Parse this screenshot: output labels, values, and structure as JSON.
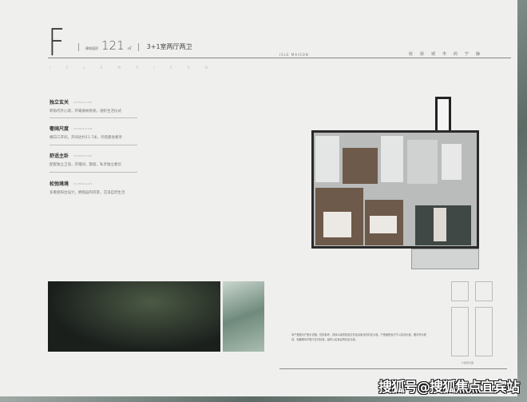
{
  "unit": {
    "letter": "F",
    "area_label": "建筑面积",
    "area": "121",
    "area_unit": "㎡",
    "layout": "3+1室两厅两卫",
    "subtitle": "I S L E M A I S O N"
  },
  "header": {
    "brand": "ISLE MAISON",
    "tagline": "收获城市的宁静"
  },
  "features": [
    {
      "title": "独立玄关",
      "en": "ISLEMAISON",
      "desc": "转角内外心境，开箱收纳系统，进阶生活仪式"
    },
    {
      "title": "奢阔尺度",
      "en": "ISLEMAISON",
      "desc": "横向三开间，开间达约11.7米，尽揽都会奢享"
    },
    {
      "title": "舒适主卧",
      "en": "ISLEMAISON",
      "desc": "配套独立卫浴，衣帽间，飘窗，私享独立奢华"
    },
    {
      "title": "松弛境境",
      "en": "ISLEMAISON",
      "desc": "多重窗阳台设计，拥揽园内风景，沉浸自然生活"
    }
  ],
  "description": "本户型图为户型示意图，仅供参考，具体以政府批准文件及买卖合同约定为准。户型面积及尺寸以实测为准，图中所示家具、电器等均不属于交付标准，最终以买卖合同约定为准。",
  "minimap_label": "户型索引图",
  "watermark": "搜狐号@搜狐焦点宜宾站",
  "colors": {
    "card": "#efefee",
    "wood": "#6e5a4a",
    "marble": "#3f4845",
    "floor": "#b9bcba"
  }
}
